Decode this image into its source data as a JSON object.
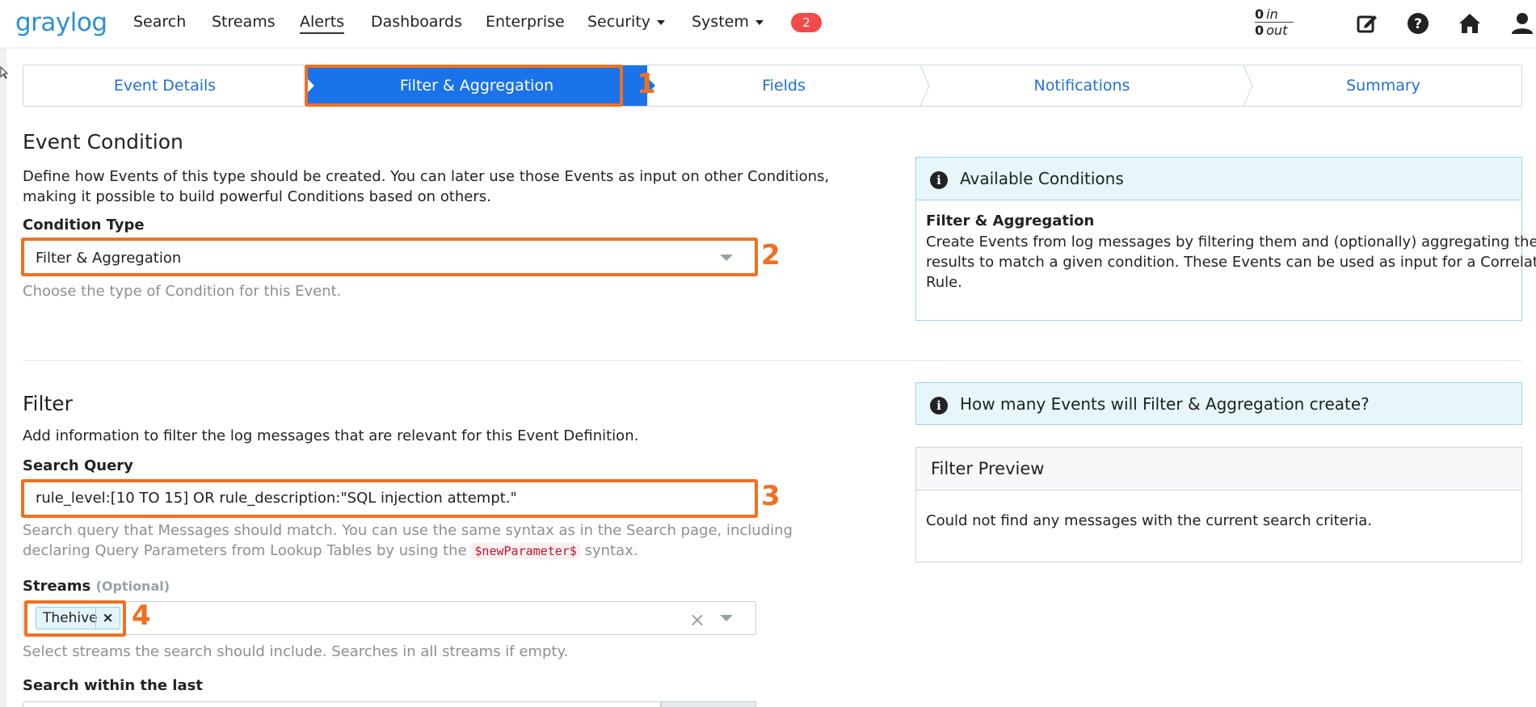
{
  "navbar": {
    "logo": "graylog",
    "items": [
      {
        "label": "Search"
      },
      {
        "label": "Streams"
      },
      {
        "label": "Alerts"
      },
      {
        "label": "Dashboards"
      },
      {
        "label": "Enterprise"
      },
      {
        "label": "Security"
      },
      {
        "label": "System"
      }
    ],
    "notification_count": "2",
    "throughput": {
      "in_value": "0",
      "in_label": "in",
      "out_value": "0",
      "out_label": "out"
    }
  },
  "wizard": {
    "steps": [
      {
        "label": "Event Details"
      },
      {
        "label": "Filter & Aggregation"
      },
      {
        "label": "Fields"
      },
      {
        "label": "Notifications"
      },
      {
        "label": "Summary"
      }
    ],
    "active_color": "#1a73e8"
  },
  "annotations": {
    "n1": "1",
    "n2": "2",
    "n3": "3",
    "n4": "4",
    "color": "#f07020"
  },
  "event_condition": {
    "title": "Event Condition",
    "description_line1": "Define how Events of this type should be created. You can later use those Events as input on other Conditions,",
    "description_line2": "making it possible to build powerful Conditions based on others.",
    "condition_type_label": "Condition Type",
    "condition_type_value": "Filter & Aggregation",
    "condition_type_help": "Choose the type of Condition for this Event."
  },
  "available_conditions": {
    "title": "Available Conditions",
    "item_title": "Filter & Aggregation",
    "item_line1": "Create Events from log messages by filtering them and (optionally) aggregating their",
    "item_line2": "results to match a given condition. These Events can be used as input for a Correlation",
    "item_line3": "Rule."
  },
  "filter": {
    "title": "Filter",
    "description": "Add information to filter the log messages that are relevant for this Event Definition.",
    "search_query_label": "Search Query",
    "search_query_value": "rule_level:[10 TO 15] OR rule_description:\"SQL injection attempt.\"",
    "search_query_help_line1": "Search query that Messages should match. You can use the same syntax as in the Search page, including",
    "search_query_help_line2_pre": "declaring Query Parameters from Lookup Tables by using the",
    "search_query_help_code": "$newParameter$",
    "search_query_help_line2_post": "syntax.",
    "streams_label": "Streams",
    "streams_optional": "(Optional)",
    "streams_tags": [
      {
        "label": "Thehive",
        "remove": "×"
      }
    ],
    "streams_clear": "×",
    "streams_help": "Select streams the search should include. Searches in all streams if empty.",
    "search_within_label": "Search within the last"
  },
  "events_info": {
    "title": "How many Events will Filter & Aggregation create?"
  },
  "filter_preview": {
    "title": "Filter Preview",
    "message": "Could not find any messages with the current search criteria."
  }
}
